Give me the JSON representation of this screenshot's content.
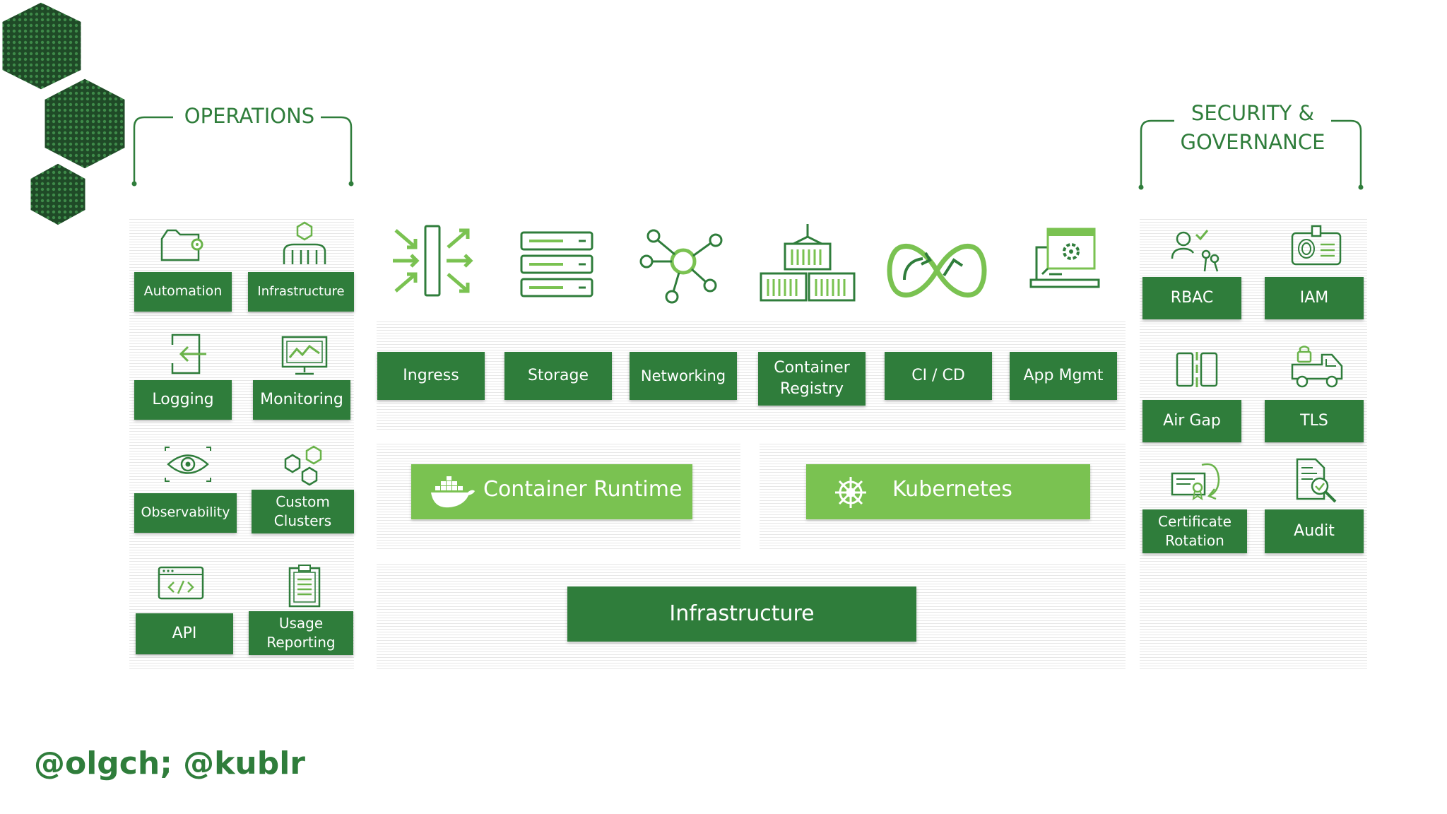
{
  "operations": {
    "heading": "OPERATIONS",
    "items": [
      {
        "label": "Automation",
        "icon": "folder-gear-icon"
      },
      {
        "label": "Infrastructure",
        "icon": "building-icon"
      },
      {
        "label": "Logging",
        "icon": "login-icon"
      },
      {
        "label": "Monitoring",
        "icon": "monitor-chart-icon"
      },
      {
        "label": "Observability",
        "icon": "eye-icon"
      },
      {
        "label": "Custom Clusters",
        "icon": "hexagons-icon"
      },
      {
        "label": "API",
        "icon": "code-window-icon"
      },
      {
        "label": "Usage Reporting",
        "icon": "clipboard-icon"
      }
    ]
  },
  "center": {
    "services": [
      {
        "label": "Ingress",
        "icon": "ingress-arrows-icon"
      },
      {
        "label": "Storage",
        "icon": "storage-server-icon"
      },
      {
        "label": "Networking",
        "icon": "network-hub-icon"
      },
      {
        "label": "Container Registry",
        "icon": "container-stack-icon"
      },
      {
        "label": "CI / CD",
        "icon": "infinity-loop-icon"
      },
      {
        "label": "App Mgmt",
        "icon": "laptop-gear-icon"
      }
    ],
    "runtime": {
      "label": "Container Runtime",
      "icon": "docker-whale-icon"
    },
    "kubernetes": {
      "label": "Kubernetes",
      "icon": "helm-wheel-icon"
    },
    "infrastructure": {
      "label": "Infrastructure"
    }
  },
  "security": {
    "heading_line1": "SECURITY &",
    "heading_line2": "GOVERNANCE",
    "items": [
      {
        "label": "RBAC",
        "icon": "user-keys-icon"
      },
      {
        "label": "IAM",
        "icon": "fingerprint-card-icon"
      },
      {
        "label": "Air Gap",
        "icon": "air-gap-icon"
      },
      {
        "label": "TLS",
        "icon": "lock-truck-icon"
      },
      {
        "label": "Certificate Rotation",
        "icon": "certificate-icon"
      },
      {
        "label": "Audit",
        "icon": "document-search-icon"
      }
    ]
  },
  "footer": {
    "handle": "@olgch; @kublr"
  },
  "colors": {
    "dark_green": "#2f7d3b",
    "light_green": "#7ac251",
    "icon_green": "#6ab34a"
  }
}
